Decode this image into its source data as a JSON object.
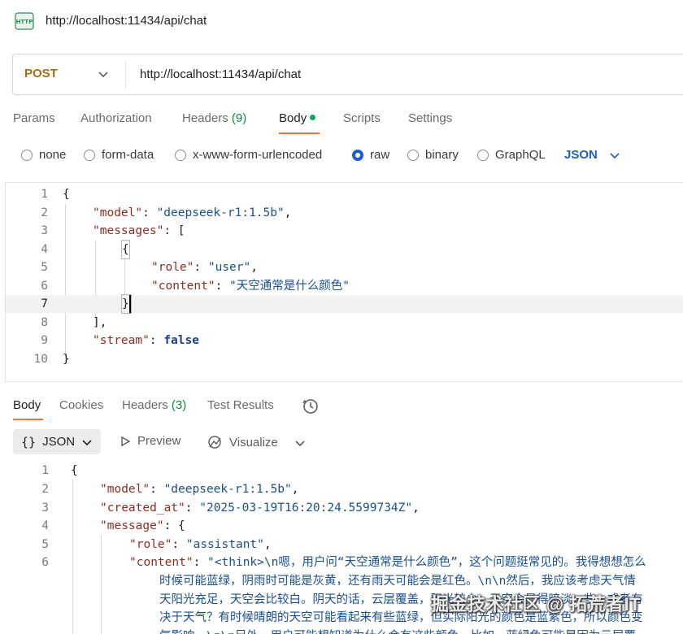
{
  "window": {
    "icon": "http-icon",
    "title": "http://localhost:11434/api/chat"
  },
  "request": {
    "method": "POST",
    "url": "http://localhost:11434/api/chat"
  },
  "request_tabs": [
    {
      "label": "Params"
    },
    {
      "label": "Authorization"
    },
    {
      "label": "Headers",
      "count": "(9)"
    },
    {
      "label": "Body",
      "active": true,
      "indicator": "green-dot"
    },
    {
      "label": "Scripts"
    },
    {
      "label": "Settings"
    }
  ],
  "body_types": {
    "options": [
      "none",
      "form-data",
      "x-www-form-urlencoded",
      "raw",
      "binary",
      "GraphQL"
    ],
    "selected": "raw",
    "format": "JSON"
  },
  "request_body": {
    "line_numbers": [
      "1",
      "2",
      "3",
      "4",
      "5",
      "6",
      "7",
      "8",
      "9",
      "10"
    ],
    "model_key": "\"model\"",
    "model_value": "\"deepseek-r1:1.5b\"",
    "messages_key": "\"messages\"",
    "role_key": "\"role\"",
    "role_value": "\"user\"",
    "content_key": "\"content\"",
    "content_value": "\"天空通常是什么颜色\"",
    "stream_key": "\"stream\"",
    "stream_value": "false"
  },
  "response_tabs": [
    {
      "label": "Body",
      "active": true
    },
    {
      "label": "Cookies"
    },
    {
      "label": "Headers",
      "count": "(3)"
    },
    {
      "label": "Test Results"
    }
  ],
  "response_toolbar": {
    "format_icon": "{}",
    "format": "JSON",
    "preview": "Preview",
    "visualize": "Visualize"
  },
  "response_body": {
    "line_numbers": [
      "1",
      "2",
      "3",
      "4",
      "5",
      "6"
    ],
    "model_key": "\"model\"",
    "model_value": "\"deepseek-r1:1.5b\"",
    "created_key": "\"created_at\"",
    "created_value": "\"2025-03-19T16:20:24.5599734Z\"",
    "message_key": "\"message\"",
    "role_key": "\"role\"",
    "role_value": "\"assistant\"",
    "content_key": "\"content\"",
    "content_line1": "\"<think>\\n嗯，用户问“天空通常是什么颜色”，这个问题挺常见的。我得想想怎么",
    "content_line2": "时候可能蓝绿，阴雨时可能是灰黄，还有雨天可能会是红色。\\n\\n然后，我应该考虑天气情",
    "content_line3": "天阳光充足，天空会比较白。阴天的话，云层覆盖，阳光较少，天空会显得暗淡一些，或者有",
    "content_line4": "决于天气？有时候晴朗的天空可能看起来有些蓝绿，但实际阳光的颜色是蓝紫色，所以颜色变",
    "content_line5": "气影响。\\n\\n另外，用户可能想知道为什么会有这些颜色，比如，蓝绿色可能是因为云层覆"
  },
  "watermark": "掘金技术社区 @ 拓荒者IT"
}
